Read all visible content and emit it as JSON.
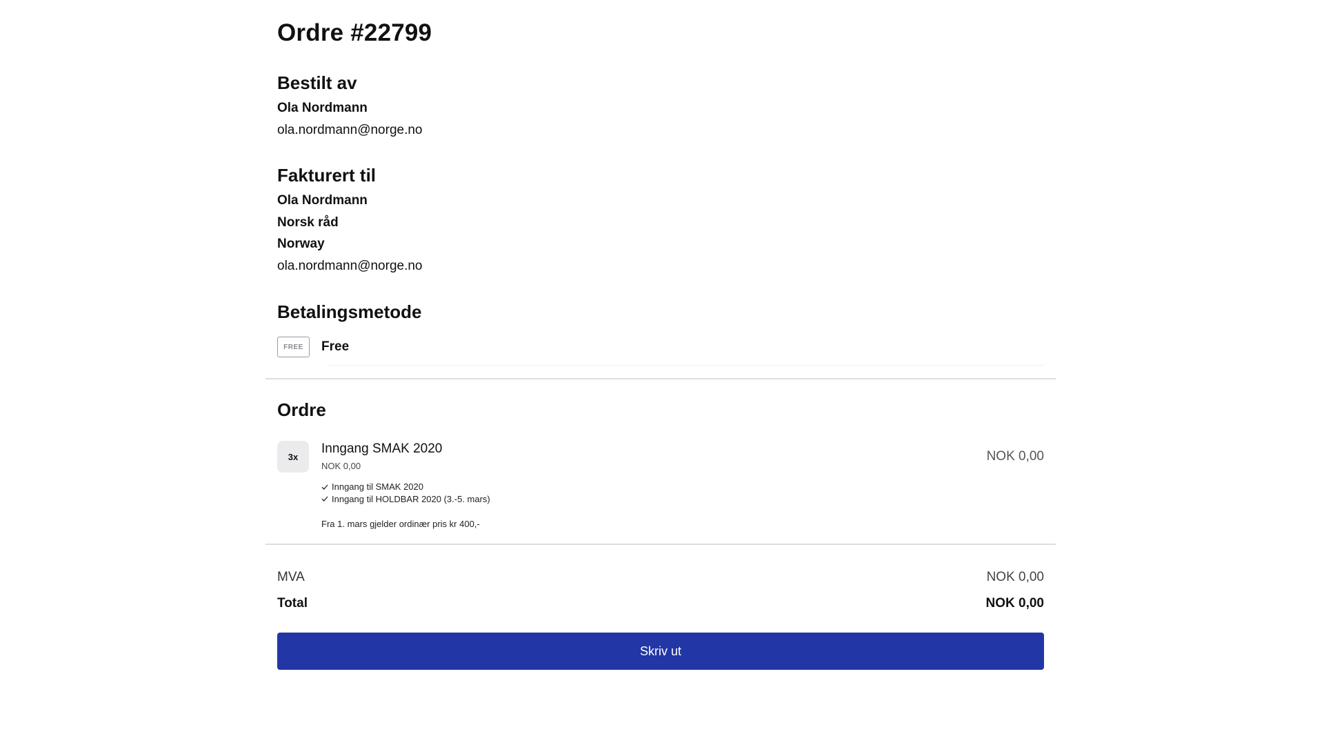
{
  "order": {
    "title": "Ordre #22799"
  },
  "ordered_by": {
    "heading": "Bestilt av",
    "name": "Ola Nordmann",
    "email": "ola.nordmann@norge.no"
  },
  "billed_to": {
    "heading": "Fakturert til",
    "name": "Ola Nordmann",
    "organization": "Norsk råd",
    "country": "Norway",
    "email": "ola.nordmann@norge.no"
  },
  "payment": {
    "heading": "Betalingsmetode",
    "badge": "FREE",
    "method": "Free"
  },
  "items_section": {
    "heading": "Ordre",
    "items": [
      {
        "quantity": "3x",
        "name": "Inngang SMAK 2020",
        "unit_price": "NOK 0,00",
        "features": [
          "Inngang til SMAK 2020",
          "Inngang til HOLDBAR 2020 (3.-5. mars)"
        ],
        "note": "Fra 1. mars gjelder ordinær pris kr 400,-",
        "line_total": "NOK 0,00"
      }
    ]
  },
  "totals": {
    "vat_label": "MVA",
    "vat_value": "NOK 0,00",
    "total_label": "Total",
    "total_value": "NOK 0,00"
  },
  "actions": {
    "print_label": "Skriv ut"
  },
  "colors": {
    "primary_button": "#2236a6",
    "divider": "#dddde0"
  }
}
